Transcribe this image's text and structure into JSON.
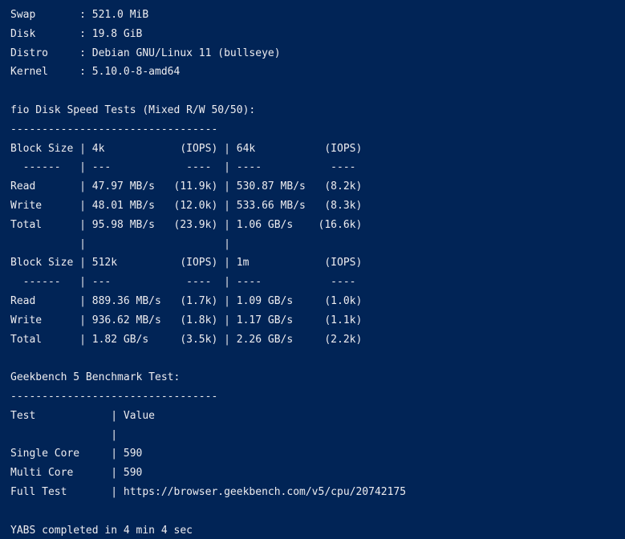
{
  "terminal": {
    "lines": [
      "Swap       : 521.0 MiB",
      "Disk       : 19.8 GiB",
      "Distro     : Debian GNU/Linux 11 (bullseye)",
      "Kernel     : 5.10.0-8-amd64",
      "",
      "fio Disk Speed Tests (Mixed R/W 50/50):",
      "---------------------------------",
      "Block Size | 4k            (IOPS) | 64k           (IOPS)",
      "  ------   | ---            ----  | ----           ----",
      "Read       | 47.97 MB/s   (11.9k) | 530.87 MB/s   (8.2k)",
      "Write      | 48.01 MB/s   (12.0k) | 533.66 MB/s   (8.3k)",
      "Total      | 95.98 MB/s   (23.9k) | 1.06 GB/s    (16.6k)",
      "           |                      |",
      "Block Size | 512k          (IOPS) | 1m            (IOPS)",
      "  ------   | ---            ----  | ----           ----",
      "Read       | 889.36 MB/s   (1.7k) | 1.09 GB/s     (1.0k)",
      "Write      | 936.62 MB/s   (1.8k) | 1.17 GB/s     (1.1k)",
      "Total      | 1.82 GB/s     (3.5k) | 2.26 GB/s     (2.2k)",
      "",
      "Geekbench 5 Benchmark Test:",
      "---------------------------------",
      "Test            | Value",
      "                |",
      "Single Core     | 590",
      "Multi Core      | 590",
      "Full Test       | https://browser.geekbench.com/v5/cpu/20742175",
      "",
      "YABS completed in 4 min 4 sec"
    ]
  },
  "colors": {
    "background": "#012456",
    "foreground": "#eeedf0"
  }
}
